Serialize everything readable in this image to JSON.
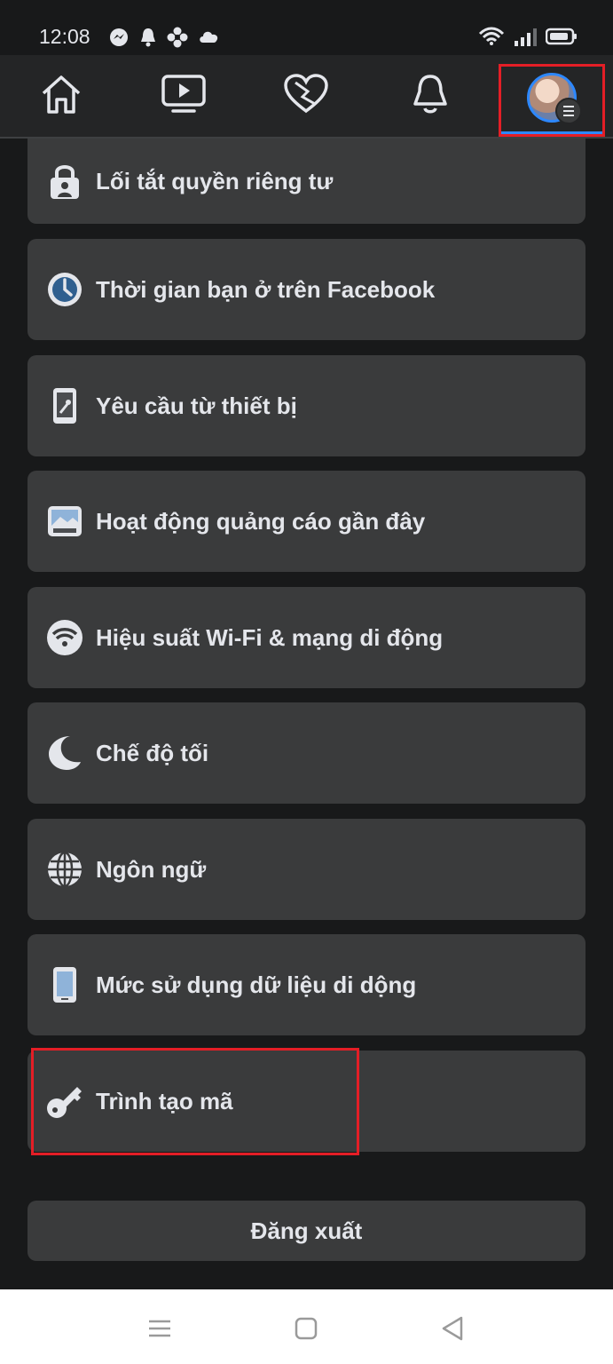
{
  "status_bar": {
    "time": "12:08",
    "left_icons": [
      "messenger-icon",
      "notification-bell-icon",
      "flower-icon",
      "cloud-icon"
    ],
    "right_icons": [
      "wifi-icon",
      "signal-icon",
      "battery-icon"
    ]
  },
  "nav": {
    "items": [
      "home-icon",
      "watch-video-icon",
      "dating-heart-icon",
      "notifications-bell-icon",
      "profile-menu-avatar"
    ],
    "active_index": 4,
    "accent_color": "#2d88ff"
  },
  "menu": {
    "items": [
      {
        "label": "Lối tắt quyền riêng tư",
        "icon": "lock-icon"
      },
      {
        "label": "Thời gian bạn ở trên Facebook",
        "icon": "clock-icon"
      },
      {
        "label": "Yêu cầu từ thiết bị",
        "icon": "device-key-icon"
      },
      {
        "label": "Hoạt động quảng cáo gần đây",
        "icon": "ad-image-icon"
      },
      {
        "label": "Hiệu suất Wi-Fi & mạng di động",
        "icon": "wifi-icon"
      },
      {
        "label": "Chế độ tối",
        "icon": "moon-icon"
      },
      {
        "label": "Ngôn ngữ",
        "icon": "globe-icon"
      },
      {
        "label": "Mức sử dụng dữ liệu di dộng",
        "icon": "phone-icon"
      },
      {
        "label": "Trình tạo mã",
        "icon": "key-icon"
      }
    ]
  },
  "logout_label": "Đăng xuất",
  "system_nav": [
    "menu-lines-icon",
    "home-square-icon",
    "back-triangle-icon"
  ],
  "colors": {
    "background": "#18191a",
    "card": "#3a3b3c",
    "highlight": "#e41e26"
  }
}
